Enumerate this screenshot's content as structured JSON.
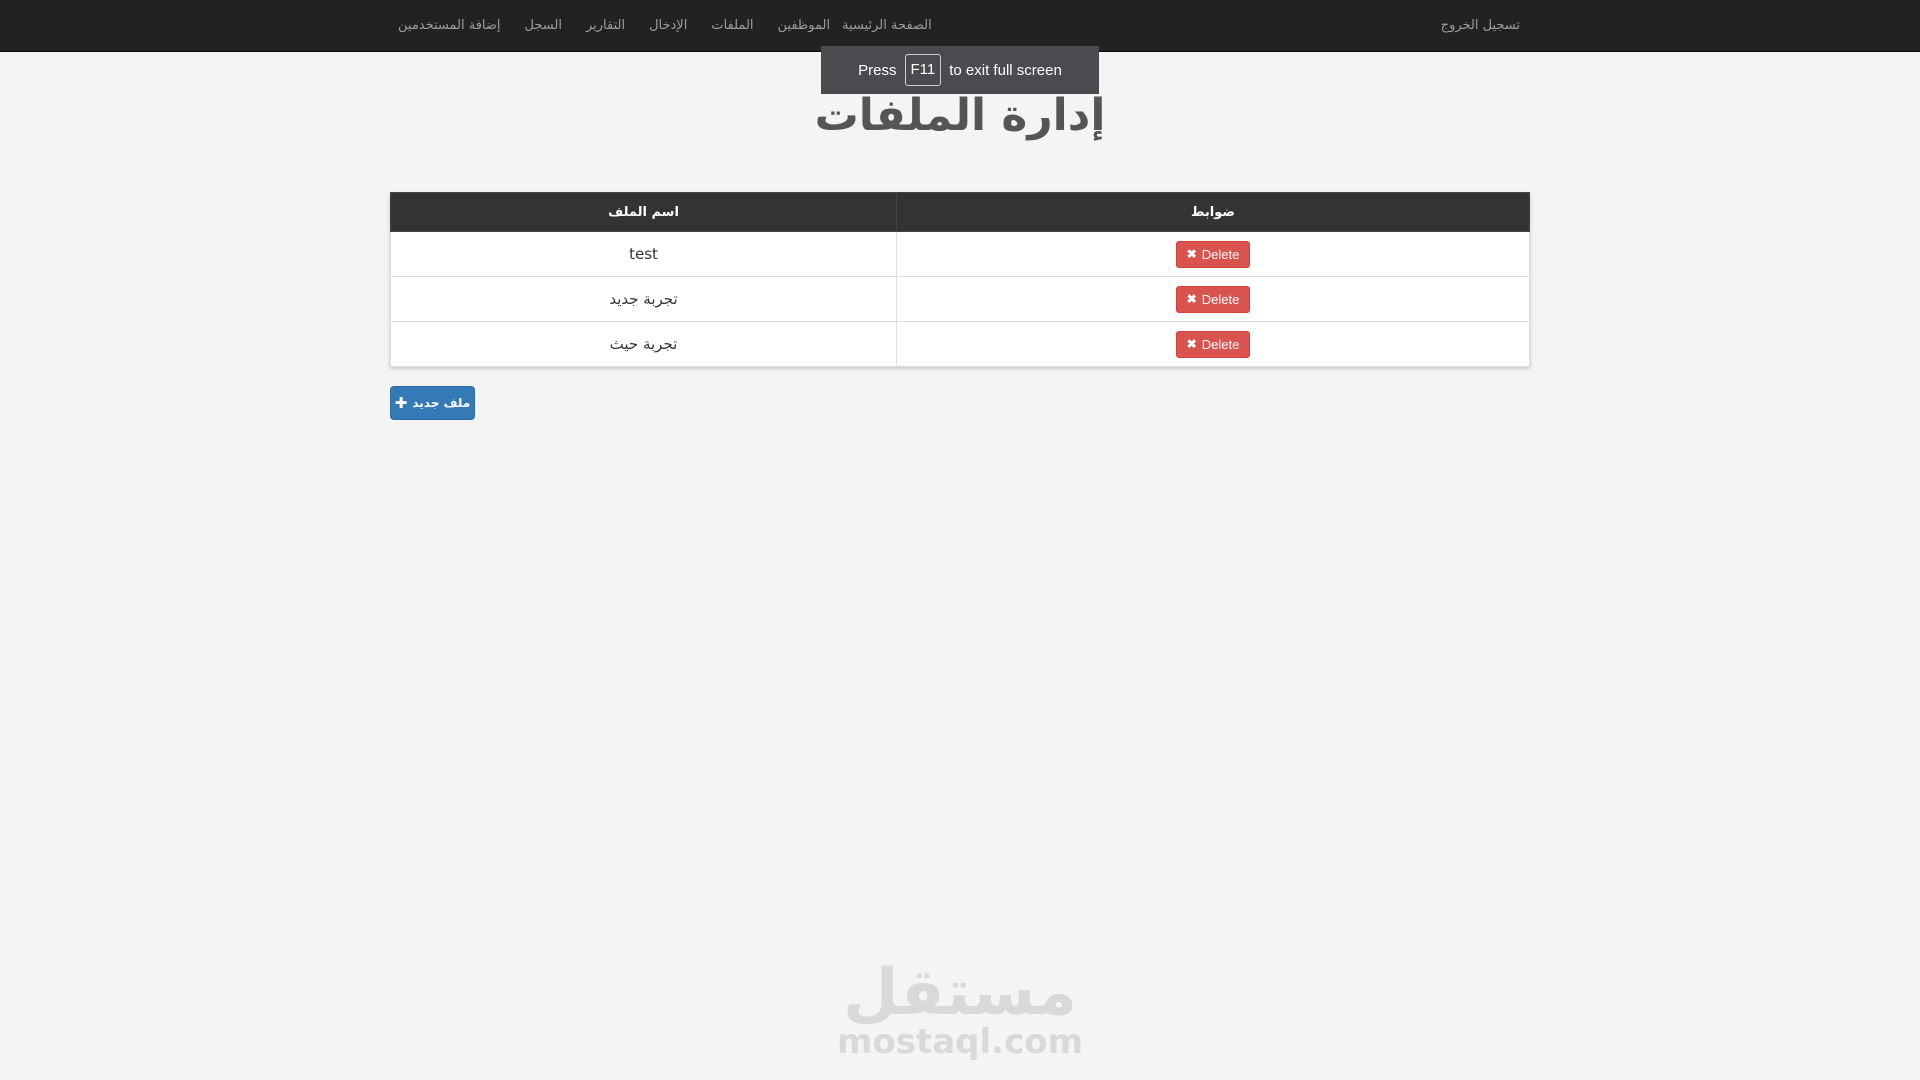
{
  "navbar": {
    "links": [
      "الصفحة الرئيسية",
      "الموظفين",
      "الملفات",
      "الإدخال",
      "التقارير",
      "السجل",
      "إضافة المستخدمين"
    ],
    "logout": "تسجيل الخروج"
  },
  "toast": {
    "press": "Press",
    "key": "F11",
    "rest": "to exit full screen"
  },
  "page": {
    "title": "إدارة الملفات"
  },
  "table": {
    "headers": {
      "name": "اسم الملف",
      "controls": "ضوابط"
    },
    "rows": [
      {
        "name": "test",
        "action": "Delete"
      },
      {
        "name": "تجربة جديد",
        "action": "Delete"
      },
      {
        "name": "تجربة حيث",
        "action": "Delete"
      }
    ]
  },
  "new_file_button": "ملف جديد",
  "watermark": {
    "arabic": "مستقل",
    "english": "mostaql.com"
  },
  "colors": {
    "navbar": "#222222",
    "danger": "#d9534f",
    "primary": "#337ab7",
    "header": "#333333"
  }
}
